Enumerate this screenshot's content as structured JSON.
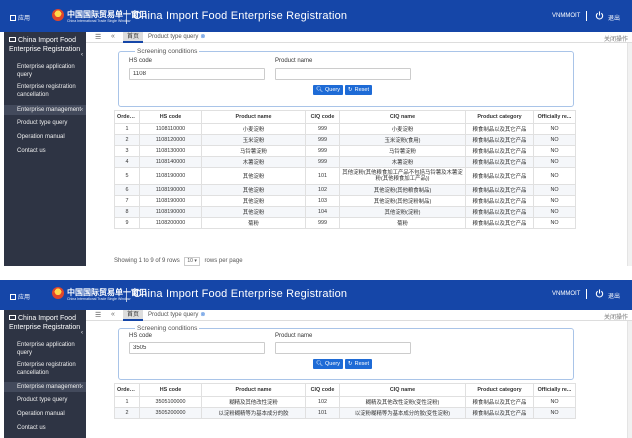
{
  "topbar": {
    "menu_label": "应用",
    "logo_cn": "中国国际贸易单一窗口",
    "logo_en": "China International Trade Single Window",
    "title": "China Import Food Enterprise Registration",
    "user": "VNMMOIT",
    "logout": "退出"
  },
  "sidebar": {
    "title": "China Import Food Enterprise Registration",
    "items": [
      "Enterprise application query",
      "Enterprise registration cancellation",
      "Enterprise management",
      "Product type query",
      "Operation manual",
      "Contact us"
    ]
  },
  "tabs": {
    "home": "首页",
    "product_type": "Product type query",
    "close_ops": "关闭操作"
  },
  "search": {
    "legend": "Screening conditions",
    "hs_label": "HS code",
    "product_label": "Product name",
    "query_btn": "Query",
    "reset_btn": "Reset"
  },
  "table_headers": [
    "Order ...",
    "HS code",
    "Product name",
    "CIQ code",
    "CIQ name",
    "Product category",
    "Officially re..."
  ],
  "screen1": {
    "hs_value": "1108",
    "product_value": "",
    "rows": [
      [
        "1",
        "1108110000",
        "小麦淀粉",
        "999",
        "小麦淀粉",
        "粮食制品以及其它产品",
        "NO"
      ],
      [
        "2",
        "1108120000",
        "玉米淀粉",
        "999",
        "玉米淀粉(食用)",
        "粮食制品以及其它产品",
        "NO"
      ],
      [
        "3",
        "1108130000",
        "马铃薯淀粉",
        "999",
        "马铃薯淀粉",
        "粮食制品以及其它产品",
        "NO"
      ],
      [
        "4",
        "1108140000",
        "木薯淀粉",
        "999",
        "木薯淀粉",
        "粮食制品以及其它产品",
        "NO"
      ],
      [
        "5",
        "1108190000",
        "其他淀粉",
        "101",
        "其他淀粉(其他粮食加工产品不包括马铃薯及木薯淀粉(其他粮食加工产品))",
        "粮食制品以及其它产品",
        "NO"
      ],
      [
        "6",
        "1108190000",
        "其他淀粉",
        "102",
        "其他淀粉(其他粮食制品)",
        "粮食制品以及其它产品",
        "NO"
      ],
      [
        "7",
        "1108190000",
        "其他淀粉",
        "103",
        "其他淀粉(其他淀粉制品)",
        "粮食制品以及其它产品",
        "NO"
      ],
      [
        "8",
        "1108190000",
        "其他淀粉",
        "104",
        "其他淀粉(淀粉)",
        "粮食制品以及其它产品",
        "NO"
      ],
      [
        "9",
        "1108200000",
        "菊粉",
        "999",
        "菊粉",
        "粮食制品以及其它产品",
        "NO"
      ]
    ],
    "pager_text": "Showing 1 to 9 of 9 rows",
    "page_size": "10",
    "per_page_text": "rows per page"
  },
  "screen2": {
    "hs_value": "3505",
    "product_value": "",
    "rows": [
      [
        "1",
        "3505100000",
        "糊精及其他改性淀粉",
        "102",
        "糊精及其他改性淀粉(变性淀粉)",
        "粮食制品以及其它产品",
        "NO"
      ],
      [
        "2",
        "3505200000",
        "以淀粉糊精等为基本成分的胶",
        "101",
        "以淀粉糊精等为基本成分的胶(变性淀粉)",
        "粮食制品以及其它产品",
        "NO"
      ]
    ]
  },
  "colors": {
    "brand_blue": "#1546a8",
    "sidebar_bg": "#2e3444",
    "button_blue": "#1e6bd6"
  },
  "icons": [
    "apps-icon",
    "emblem-icon",
    "power-icon",
    "id-card-icon",
    "menu-icon",
    "double-left-icon",
    "search-icon",
    "refresh-icon",
    "close-icon"
  ]
}
